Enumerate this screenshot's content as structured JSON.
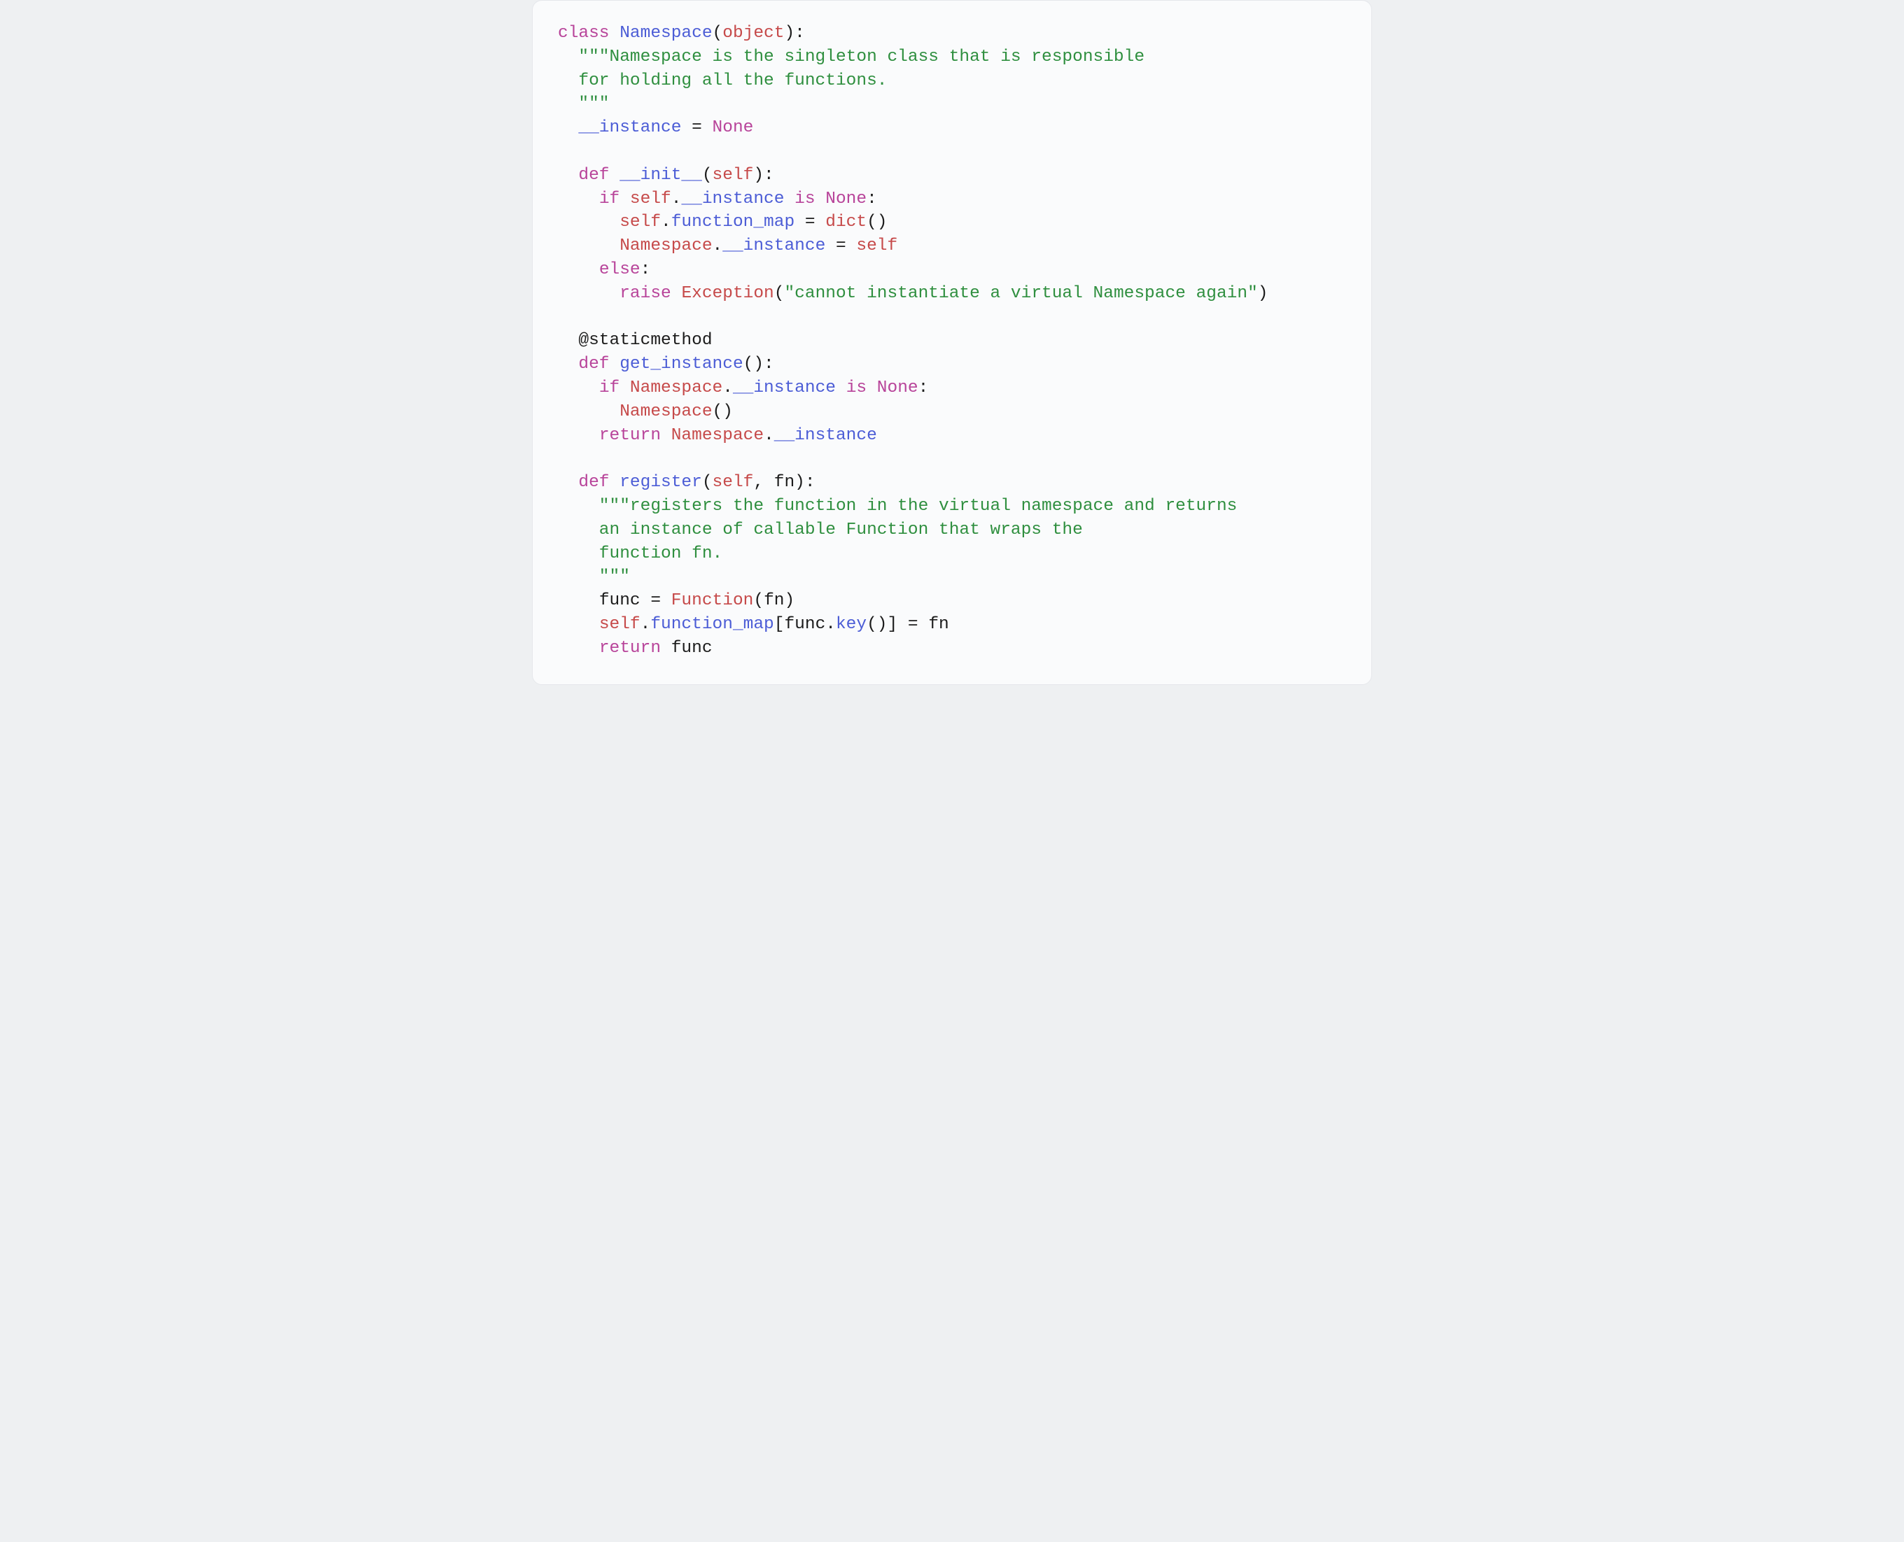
{
  "code": {
    "line1": {
      "kw_class": "class ",
      "cls": "Namespace",
      "p1": "(",
      "obj": "object",
      "p2": "):"
    },
    "line2": "  \"\"\"Namespace is the singleton class that is responsible",
    "line3": "  for holding all the functions.",
    "line4": "  \"\"\"",
    "line5": {
      "indent": "  ",
      "inst": "__instance",
      "eq": " = ",
      "none": "None"
    },
    "line7": {
      "indent": "  ",
      "kw_def": "def ",
      "fn": "__init__",
      "p1": "(",
      "self": "self",
      "p2": "):"
    },
    "line8": {
      "indent": "    ",
      "kw_if": "if ",
      "self": "self",
      "dot": ".",
      "inst": "__instance",
      "sp": " ",
      "kw_is": "is",
      "sp2": " ",
      "none": "None",
      "colon": ":"
    },
    "line9": {
      "indent": "      ",
      "self": "self",
      "dot": ".",
      "fmap": "function_map",
      "eq": " = ",
      "dict": "dict",
      "paren": "()"
    },
    "line10": {
      "indent": "      ",
      "cls": "Namespace",
      "dot": ".",
      "inst": "__instance",
      "eq": " = ",
      "self": "self"
    },
    "line11": {
      "indent": "    ",
      "kw_else": "else",
      "colon": ":"
    },
    "line12": {
      "indent": "      ",
      "kw_raise": "raise ",
      "exc": "Exception",
      "p1": "(",
      "str": "\"cannot instantiate a virtual Namespace again\"",
      "p2": ")"
    },
    "line14": {
      "indent": "  ",
      "dec": "@staticmethod"
    },
    "line15": {
      "indent": "  ",
      "kw_def": "def ",
      "fn": "get_instance",
      "paren": "():"
    },
    "line16": {
      "indent": "    ",
      "kw_if": "if ",
      "cls": "Namespace",
      "dot": ".",
      "inst": "__instance",
      "sp": " ",
      "kw_is": "is",
      "sp2": " ",
      "none": "None",
      "colon": ":"
    },
    "line17": {
      "indent": "      ",
      "cls": "Namespace",
      "paren": "()"
    },
    "line18": {
      "indent": "    ",
      "kw_ret": "return ",
      "cls": "Namespace",
      "dot": ".",
      "inst": "__instance"
    },
    "line20": {
      "indent": "  ",
      "kw_def": "def ",
      "fn": "register",
      "p1": "(",
      "self": "self",
      "comma": ", ",
      "arg": "fn",
      "p2": "):"
    },
    "line21": "    \"\"\"registers the function in the virtual namespace and returns",
    "line22": "    an instance of callable Function that wraps the",
    "line23": "    function fn.",
    "line24": "    \"\"\"",
    "line25": {
      "indent": "    ",
      "func": "func",
      "eq": " = ",
      "Fn": "Function",
      "p1": "(",
      "arg": "fn",
      "p2": ")"
    },
    "line26": {
      "indent": "    ",
      "self": "self",
      "dot": ".",
      "fmap": "function_map",
      "b1": "[",
      "func": "func",
      "dot2": ".",
      "key": "key",
      "paren": "()",
      "b2": "]",
      "eq": " = ",
      "arg": "fn"
    },
    "line27": {
      "indent": "    ",
      "kw_ret": "return ",
      "func": "func"
    }
  }
}
